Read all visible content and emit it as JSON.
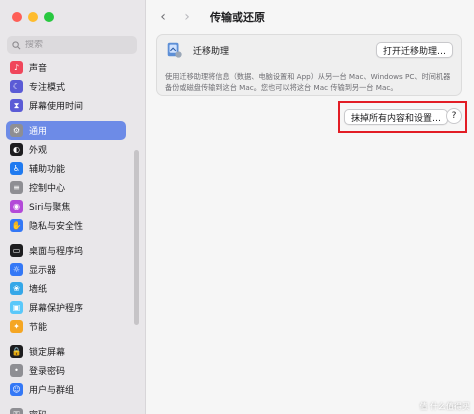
{
  "window": {
    "traffic_lights": [
      "close",
      "minimize",
      "zoom"
    ]
  },
  "sidebar": {
    "search": {
      "placeholder": "搜索",
      "value": ""
    },
    "items": [
      {
        "label": "声音",
        "icon": "speaker-icon",
        "color": "#f0465b"
      },
      {
        "label": "专注模式",
        "icon": "moon-icon",
        "color": "#5b5bd6"
      },
      {
        "label": "屏幕使用时间",
        "icon": "hourglass-icon",
        "color": "#5b5bd6"
      },
      {
        "label": "通用",
        "icon": "gear-icon",
        "color": "#8e8e93",
        "active": true
      },
      {
        "label": "外观",
        "icon": "appearance-icon",
        "color": "#1d1d1f"
      },
      {
        "label": "辅助功能",
        "icon": "accessibility-icon",
        "color": "#1f7af0"
      },
      {
        "label": "控制中心",
        "icon": "control-center-icon",
        "color": "#8e8e93"
      },
      {
        "label": "Siri与聚焦",
        "icon": "siri-icon",
        "color": "#b34ad8"
      },
      {
        "label": "隐私与安全性",
        "icon": "hand-icon",
        "color": "#3478f6"
      },
      {
        "label": "桌面与程序坞",
        "icon": "dock-icon",
        "color": "#1d1d1f"
      },
      {
        "label": "显示器",
        "icon": "display-icon",
        "color": "#3478f6"
      },
      {
        "label": "墙纸",
        "icon": "wallpaper-icon",
        "color": "#35a7e8"
      },
      {
        "label": "屏幕保护程序",
        "icon": "screensaver-icon",
        "color": "#5ac8fa"
      },
      {
        "label": "节能",
        "icon": "bulb-icon",
        "color": "#f5a623"
      },
      {
        "label": "锁定屏幕",
        "icon": "lock-icon",
        "color": "#1d1d1f"
      },
      {
        "label": "登录密码",
        "icon": "password-icon",
        "color": "#8e8e93"
      },
      {
        "label": "用户与群组",
        "icon": "users-icon",
        "color": "#3478f6"
      },
      {
        "label": "密码",
        "icon": "key-icon",
        "color": "#8e8e93"
      }
    ]
  },
  "main": {
    "back_glyph": "‹",
    "forward_glyph": "›",
    "title": "传输或还原",
    "migration": {
      "label": "迁移助理",
      "button": "打开迁移助理…",
      "description": "使用迁移助理将信息（数据、电脑设置和 App）从另一台 Mac、Windows PC、时间机器备份或磁盘传输到这台 Mac。您也可以将这台 Mac 传输到另一台 Mac。"
    },
    "erase_button": "抹掉所有内容和设置…",
    "help_button": "?"
  },
  "annotation": {
    "highlight_color": "#e21d25"
  },
  "watermark": "值 什么值得买"
}
